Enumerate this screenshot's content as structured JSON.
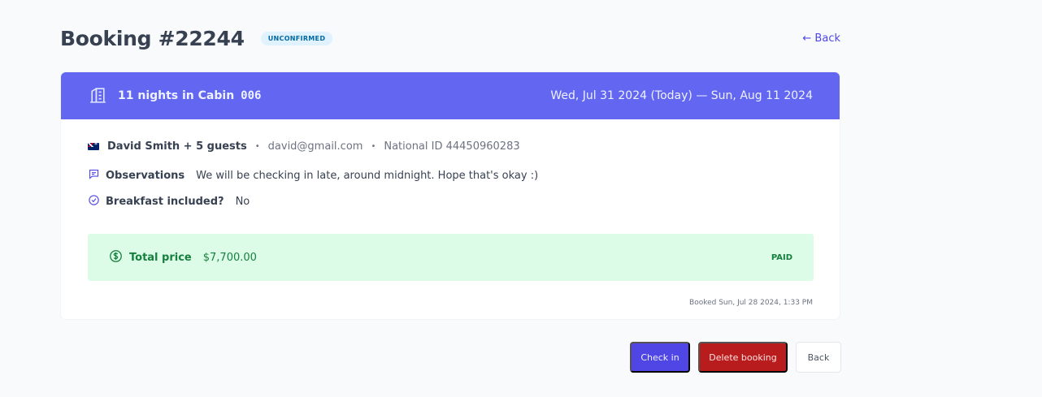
{
  "heading": {
    "title": "Booking #22244",
    "status": "unconfirmed",
    "back_link": "← Back"
  },
  "booking": {
    "nights_text": "11 nights in Cabin",
    "cabin_number": "006",
    "dates": "Wed, Jul 31 2024 (Today) — Sun, Aug 11 2024",
    "guest": {
      "name": "David Smith + 5 guests",
      "email": "david@gmail.com",
      "national_id": "National ID 44450960283",
      "separator": "•"
    },
    "observations": {
      "label": "Observations",
      "value": "We will be checking in late, around midnight. Hope that's okay :)"
    },
    "breakfast": {
      "label": "Breakfast included?",
      "value": "No"
    },
    "price": {
      "label": "Total price",
      "value": "$7,700.00",
      "status": "Paid"
    },
    "booked_at": "Booked Sun, Jul 28 2024, 1:33 PM"
  },
  "actions": {
    "check_in": "Check in",
    "delete": "Delete booking",
    "back": "Back"
  },
  "colors": {
    "accent": "#6366f1",
    "primary_button": "#4f46e5",
    "danger_button": "#b91c1c",
    "paid_bg": "#dcfce7",
    "paid_text": "#15803d"
  },
  "icons": {
    "cabin": "house-icon",
    "observations": "chat-bubble-icon",
    "breakfast": "check-circle-icon",
    "price": "dollar-circle-icon",
    "flag": "australia-flag-icon"
  }
}
